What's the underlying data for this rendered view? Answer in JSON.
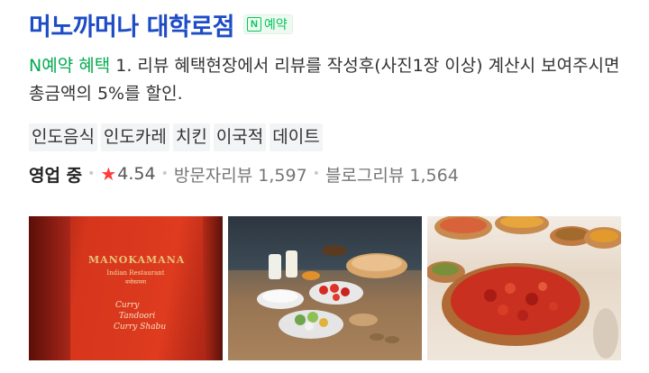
{
  "place": {
    "name": "머노까머나 대학로점",
    "badge_label": "예약",
    "badge_icon": "naver-n-icon"
  },
  "benefit": {
    "prefix": "N예약 혜택",
    "text": " 1. 리뷰 혜택현장에서 리뷰를 작성후(사진1장 이상) 계산시 보여주시면 총금액의 5%를 할인."
  },
  "tags": [
    "인도음식",
    "인도카레",
    "치킨",
    "이국적",
    "데이트"
  ],
  "status": {
    "open": "영업 중",
    "rating": "4.54",
    "visitor_reviews": "방문자리뷰 1,597",
    "blog_reviews": "블로그리뷰 1,564"
  },
  "photos": {
    "sign_name": "MANOKAMANA",
    "sign_sub": "Indian Restaurant",
    "sign_sub2": "मनोकामना",
    "menu": [
      "Curry",
      "Tandoori",
      "Curry Shabu"
    ]
  },
  "colors": {
    "title": "#1d4cc5",
    "naver_green": "#03c75a",
    "star": "#ff3b3b"
  }
}
